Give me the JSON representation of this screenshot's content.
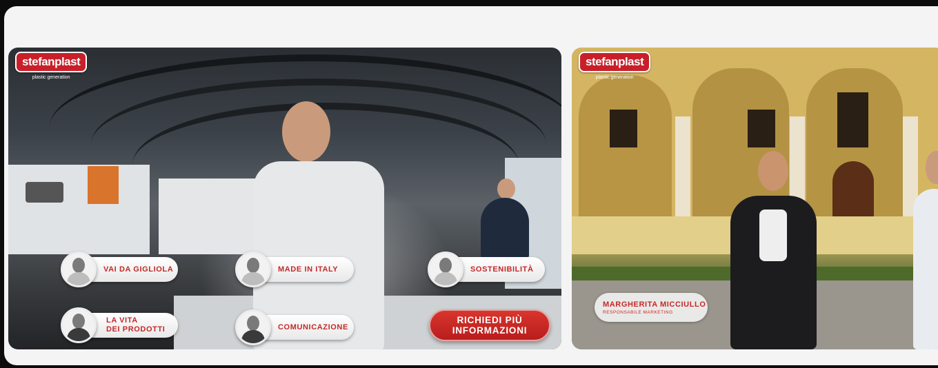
{
  "brand": {
    "logo_text": "stefanplast",
    "tagline": "plastic generation",
    "accent": "#c62828"
  },
  "video_1": {
    "hotspots": [
      {
        "label": "VAI DA GIGLIOLA",
        "avatar": "woman-portrait"
      },
      {
        "label": "MADE IN ITALY",
        "avatar": "man-portrait"
      },
      {
        "label": "SOSTENIBILITÀ",
        "avatar": "woman-portrait"
      },
      {
        "label": "LA VITA\nDEI PRODOTTI",
        "avatar": "man-portrait"
      },
      {
        "label": "COMUNICAZIONE",
        "avatar": "woman-portrait"
      }
    ],
    "cta_label": "RICHIEDI PIÙ\nINFORMAZIONI"
  },
  "video_2": {
    "person_name": "MARGHERITA MICCIULLO",
    "person_role": "RESPONSABILE MARKETING"
  }
}
